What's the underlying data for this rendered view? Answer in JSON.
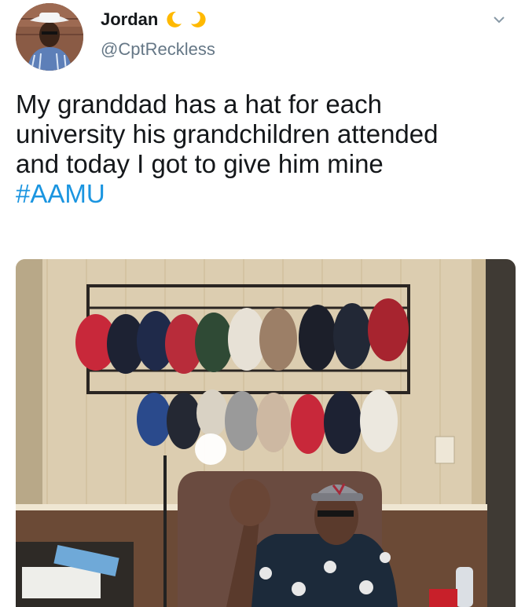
{
  "tweet": {
    "author": {
      "display_name": "Jordan",
      "handle": "@CptReckless",
      "avatar_icon": "profile-photo",
      "name_emoji": [
        "crescent-moon-icon",
        "crescent-moon-icon"
      ]
    },
    "menu_icon": "chevron-down-icon",
    "text_lines": [
      "My granddad has a hat for each",
      "university his grandchildren attended",
      "and today I got to give him mine"
    ],
    "hashtag": "#AAMU",
    "media": {
      "description_icon": "photo",
      "hat_colors_top": [
        "#c8283a",
        "#1d2233",
        "#1f2a4a",
        "#b82c3a",
        "#2f4a35",
        "#e7e1d6",
        "#9c7f67",
        "#1c1f2a",
        "#222836",
        "#a7242f"
      ],
      "hat_colors_bottom": [
        "#2a4a8c",
        "#242833",
        "#d9d2c4",
        "#9a9a9a",
        "#cdb8a2",
        "#c8283a",
        "#1d2233",
        "#ece8df"
      ]
    },
    "colors": {
      "text": "#14171a",
      "secondary": "#657786",
      "link": "#1b95e0",
      "moon": "#ffb900"
    }
  }
}
